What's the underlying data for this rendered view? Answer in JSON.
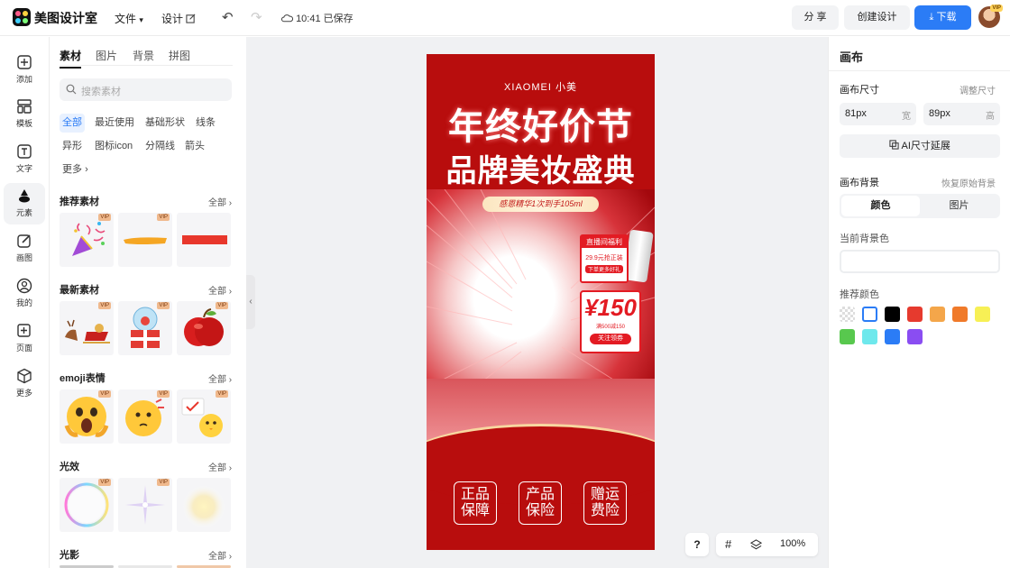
{
  "topbar": {
    "app_name": "美图设计室",
    "menu_file": "文件",
    "menu_design": "设计",
    "save_status": "10:41 已保存",
    "share_label": "分 享",
    "create_label": "创建设计",
    "download_label": "下载",
    "avatar_badge": "VIP"
  },
  "rail": {
    "items": [
      {
        "label": "添加",
        "icon": "plus-square-icon"
      },
      {
        "label": "模板",
        "icon": "template-icon"
      },
      {
        "label": "文字",
        "icon": "text-icon"
      },
      {
        "label": "元素",
        "icon": "shapes-icon"
      },
      {
        "label": "画图",
        "icon": "draw-icon"
      },
      {
        "label": "我的",
        "icon": "user-icon"
      },
      {
        "label": "页面",
        "icon": "page-add-icon"
      },
      {
        "label": "更多",
        "icon": "cube-icon"
      }
    ],
    "active": "元素"
  },
  "panel": {
    "tabs": [
      "素材",
      "图片",
      "背景",
      "拼图"
    ],
    "search_placeholder": "搜索素材",
    "chips": [
      "全部",
      "最近使用",
      "基础形状",
      "线条",
      "异形",
      "图标icon",
      "分隔线",
      "箭头",
      "更多"
    ],
    "sections": [
      {
        "title": "推荐素材",
        "more": "全部"
      },
      {
        "title": "最新素材",
        "more": "全部"
      },
      {
        "title": "emoji表情",
        "more": "全部"
      },
      {
        "title": "光效",
        "more": "全部"
      },
      {
        "title": "光影",
        "more": "全部"
      }
    ],
    "vip_badge": "VIP"
  },
  "poster": {
    "brand": "XIAOMEI 小美",
    "title1": "年终好价节",
    "title2": "品牌美妆盛典",
    "pill": "感恩精华1次到手105ml",
    "tag_head": "直播间福利",
    "tag_price": "29.9元抢正装",
    "tag_sub": "下单更多好礼",
    "coupon_amount": "¥150",
    "coupon_sub": "满500减150",
    "coupon_go": "关注领券",
    "guarantees": [
      {
        "line1": "正品",
        "line2": "保障"
      },
      {
        "line1": "产品",
        "line2": "保险"
      },
      {
        "line1": "赠运",
        "line2": "费险"
      }
    ]
  },
  "canvas_tools": {
    "help": "?",
    "zoom": "100%"
  },
  "rpanel": {
    "title": "画布",
    "size_label": "画布尺寸",
    "size_link": "调整尺寸",
    "width_value": "81px",
    "width_unit": "宽",
    "height_value": "89px",
    "height_unit": "高",
    "ai_extend": "AI尺寸延展",
    "bg_label": "画布背景",
    "bg_restore": "恢复原始背景",
    "seg_color": "颜色",
    "seg_image": "图片",
    "current_bg": "当前背景色",
    "recommend": "推荐颜色",
    "swatches": [
      "#ffffff",
      "#000000",
      "#e63a2e",
      "#f4a64a",
      "#f07a2a",
      "#f7f055",
      "#58c84e",
      "#6ee8ec",
      "#2b7cf6",
      "#8a4df2"
    ]
  }
}
